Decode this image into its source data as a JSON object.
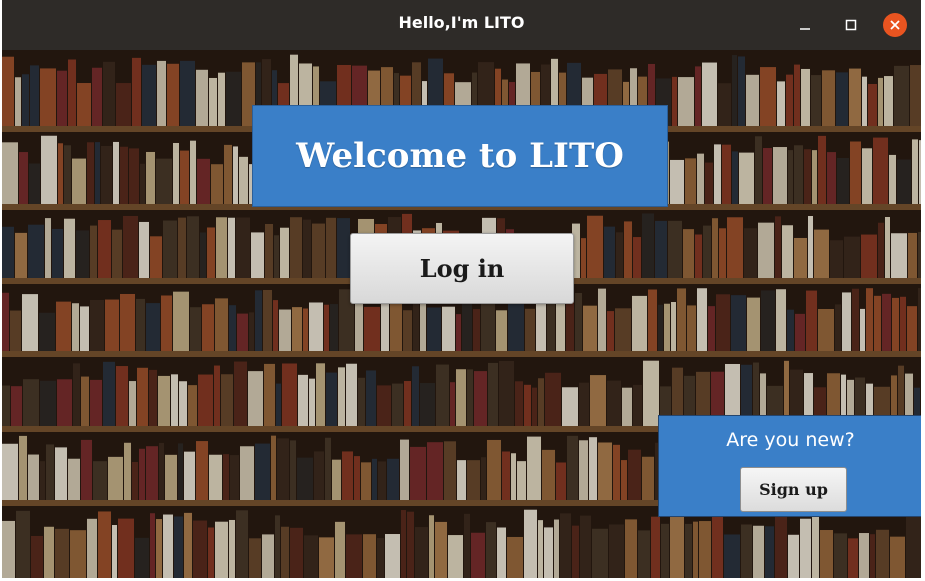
{
  "window": {
    "title": "Hello,I'm LITO",
    "controls": {
      "minimize_icon": "minimize-icon",
      "maximize_icon": "maximize-icon",
      "close_icon": "close-icon",
      "close_color": "#e95420"
    }
  },
  "background": {
    "image": "bookshelf-library-photo",
    "wood_color": "#7a5530",
    "gap_color": "#2a1c12"
  },
  "welcome": {
    "title": "Welcome to LITO",
    "color": "#3a7fc8"
  },
  "login": {
    "label": "Log in"
  },
  "signup": {
    "question": "Are you new?",
    "label": "Sign up",
    "panel_color": "#3a7fc8"
  }
}
